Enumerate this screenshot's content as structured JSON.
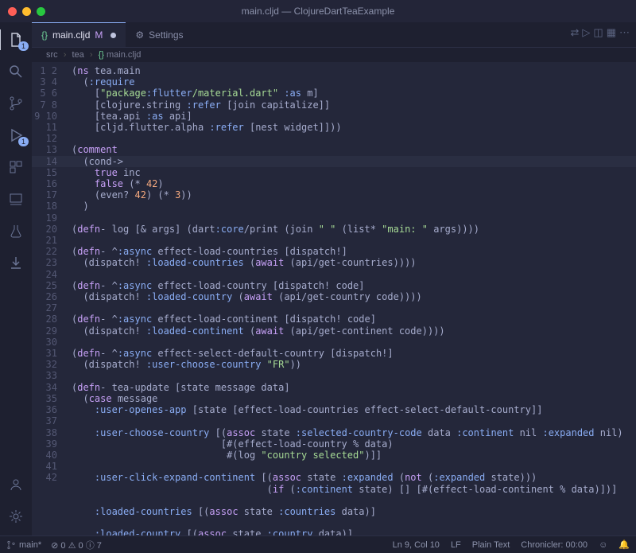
{
  "window": {
    "title": "main.cljd — ClojureDartTeaExample"
  },
  "tabs": [
    {
      "icon": "clojure-file-icon",
      "label": "main.cljd",
      "modifier": "M",
      "dirty": true,
      "active": true
    },
    {
      "icon": "settings-icon",
      "label": "Settings",
      "dirty": false,
      "active": false
    }
  ],
  "breadcrumb": {
    "segments": [
      "src",
      "tea",
      "main.cljd"
    ]
  },
  "activity": {
    "items": [
      "files-icon",
      "search-icon",
      "branch-icon",
      "run-icon",
      "extensions-icon",
      "remote-icon",
      "beaker-icon",
      "pull-icon"
    ],
    "badges": {
      "files-icon": "1",
      "run-icon": "1"
    },
    "bottom": [
      "account-icon",
      "gear-icon"
    ]
  },
  "editor": {
    "current_line": 9,
    "lines": [
      "(ns tea.main",
      "  (:require",
      "    [\"package:flutter/material.dart\" :as m]",
      "    [clojure.string :refer [join capitalize]]",
      "    [tea.api :as api]",
      "    [cljd.flutter.alpha :refer [nest widget]]))",
      "",
      "(comment",
      "  (cond->  ",
      "    true inc",
      "    false (* 42)",
      "    (even? 42) (* 3))",
      "  )",
      "",
      "(defn- log [& args] (dart:core/print (join \" \" (list* \"main: \" args))))",
      "",
      "(defn- ^:async effect-load-countries [dispatch!]",
      "  (dispatch! :loaded-countries (await (api/get-countries))))",
      "",
      "(defn- ^:async effect-load-country [dispatch! code]",
      "  (dispatch! :loaded-country (await (api/get-country code))))",
      "",
      "(defn- ^:async effect-load-continent [dispatch! code]",
      "  (dispatch! :loaded-continent (await (api/get-continent code))))",
      "",
      "(defn- ^:async effect-select-default-country [dispatch!]",
      "  (dispatch! :user-choose-country \"FR\"))",
      "",
      "(defn- tea-update [state message data]",
      "  (case message",
      "    :user-openes-app [state [effect-load-countries effect-select-default-country]]",
      "",
      "    :user-choose-country [(assoc state :selected-country-code data :continent nil :expanded nil)",
      "                          [#(effect-load-country % data)",
      "                           #(log \"country selected\")]]",
      "",
      "    :user-click-expand-continent [(assoc state :expanded (not (:expanded state)))",
      "                                  (if (:continent state) [] [#(effect-load-continent % data)])]",
      "",
      "    :loaded-countries [(assoc state :countries data)]",
      "",
      "    :loaded-country [(assoc state :country data)]"
    ]
  },
  "status": {
    "branch": "main*",
    "errors": "0",
    "warnings": "0",
    "info": "7",
    "cursor": "Ln 9, Col 10",
    "eol": "LF",
    "language": "Plain Text",
    "chronicler": "Chronicler: 00:00"
  }
}
